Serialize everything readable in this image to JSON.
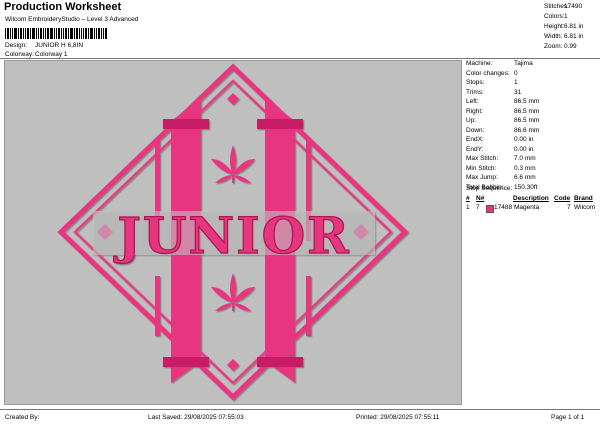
{
  "header": {
    "title": "Production Worksheet",
    "subtitle": "Wilcom EmbroideryStudio – Level 3 Advanced"
  },
  "design_info": [
    {
      "label": "Design:",
      "value": "JUNIOR H 6,8IN"
    },
    {
      "label": "Colorway:",
      "value": "Colorway 1"
    }
  ],
  "summary": [
    {
      "label": "Stitches:",
      "value": "17490"
    },
    {
      "label": "Colors:",
      "value": "1"
    },
    {
      "label": "Height:",
      "value": "6.81 in"
    },
    {
      "label": "Width:",
      "value": "6.81 in"
    },
    {
      "label": "Zoom:",
      "value": "0.99"
    }
  ],
  "design_text": "JUNIOR",
  "colors": {
    "thread": "#e8357f",
    "thread_dark": "#a8124f",
    "background": "#bfbfbf"
  },
  "machine_info": [
    {
      "label": "Machine:",
      "value": "Tajima"
    },
    {
      "label": "Color changes:",
      "value": "0"
    },
    {
      "label": "Stops:",
      "value": "1"
    },
    {
      "label": "Trims:",
      "value": "31"
    },
    {
      "label": "Left:",
      "value": "86.5 mm"
    },
    {
      "label": "Right:",
      "value": "86.5 mm"
    },
    {
      "label": "Up:",
      "value": "86.5 mm"
    },
    {
      "label": "Down:",
      "value": "86.6 mm"
    },
    {
      "label": "EndX:",
      "value": "0.00 in"
    },
    {
      "label": "EndY:",
      "value": "0.00 in"
    },
    {
      "label": "Max Stitch:",
      "value": "7.0 mm"
    },
    {
      "label": "Min Stitch:",
      "value": "0.3 mm"
    },
    {
      "label": "Max Jump:",
      "value": "6.6 mm"
    },
    {
      "label": "Total Bobbin:",
      "value": "150.30ft"
    }
  ],
  "stop_sequence": {
    "title": "Stop Sequence:",
    "headers": [
      "#",
      "N#",
      "Color",
      "Stitches",
      "Description",
      "Code",
      "Brand"
    ],
    "rows": [
      {
        "index": "1",
        "needle": "7",
        "stitches": "17488",
        "description": "Magenta",
        "code": "7",
        "brand": "Wilcom"
      }
    ]
  },
  "footer": {
    "created_by": "Created By:",
    "last_saved": "Last Saved: 29/08/2025 07:55:03",
    "printed": "Printed: 29/08/2025 07:55:11",
    "page": "Page 1 of 1"
  }
}
